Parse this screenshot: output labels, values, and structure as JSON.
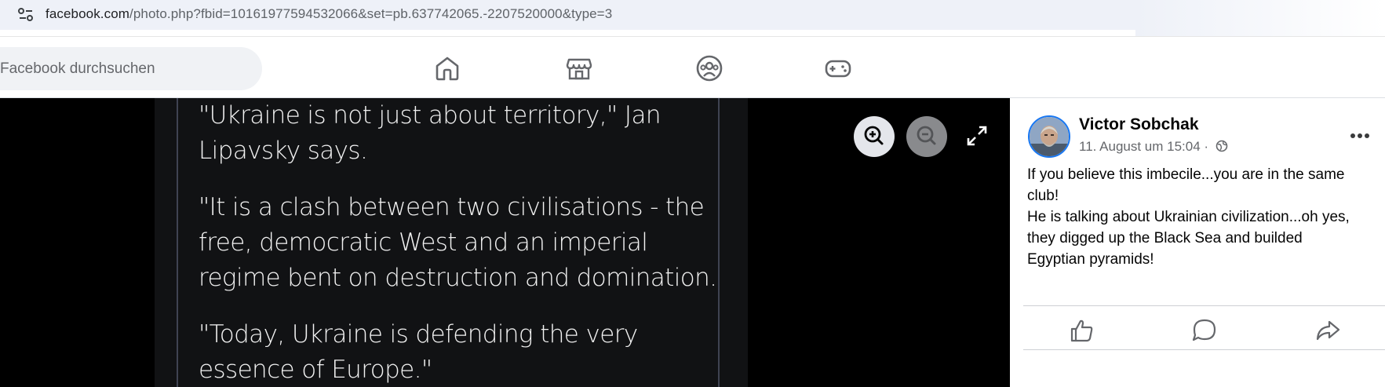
{
  "browser": {
    "url_domain": "facebook.com",
    "url_path": "/photo.php?fbid=10161977594532066&set=pb.637742065.-2207520000&type=3"
  },
  "header": {
    "search_placeholder": "Facebook durchsuchen",
    "nav_icons": [
      "home-icon",
      "marketplace-icon",
      "groups-icon",
      "gaming-icon"
    ]
  },
  "photo": {
    "paragraphs": [
      [
        "\"Ukraine is not just about territory,\" Jan",
        "Lipavsky says."
      ],
      [
        "\"It is a clash between two civilisations - the",
        "free, democratic West and an imperial",
        "regime bent on destruction and domination."
      ],
      [
        "\"Today, Ukraine is defending the very",
        "essence of Europe.\""
      ]
    ],
    "controls": [
      "zoom-in-icon",
      "zoom-out-icon",
      "fullscreen-icon"
    ]
  },
  "post": {
    "author": "Victor Sobchak",
    "date": "11. August um 15:04",
    "separator": "·",
    "audience_icon": "globe-icon",
    "text_lines": [
      "If you believe this imbecile...you are in the same",
      "club!",
      "He is talking about Ukrainian civilization...oh yes,",
      "they digged up the Black Sea and builded",
      "Egyptian pyramids!"
    ],
    "actions": [
      "like-icon",
      "comment-icon",
      "share-icon"
    ]
  },
  "colors": {
    "brand_blue": "#1877f2",
    "viewer_bg": "#000000",
    "text_secondary": "#65676b"
  }
}
